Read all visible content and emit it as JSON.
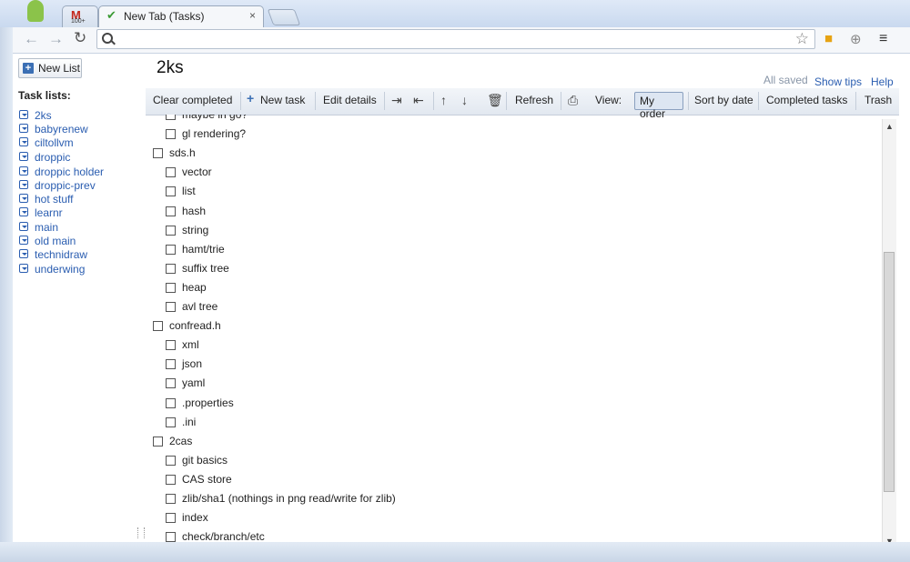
{
  "browser": {
    "tab_gmail_icon": "M",
    "tab_gmail_count": "100+",
    "active_tab_title": "New Tab (Tasks)",
    "tab_close": "×",
    "nav_back": "←",
    "nav_forward": "→",
    "nav_reload": "C",
    "address_value": "",
    "star": "☆",
    "ext_lock": "🔒",
    "ext_download": "⊕",
    "menu": "≡"
  },
  "app": {
    "new_list_label": "New List",
    "list_title": "2ks",
    "status": "All saved",
    "show_tips": "Show tips",
    "help": "Help"
  },
  "sidebar": {
    "heading": "Task lists:",
    "items": [
      {
        "label": "2ks"
      },
      {
        "label": "babyrenew"
      },
      {
        "label": "ciltollvm"
      },
      {
        "label": "droppic"
      },
      {
        "label": "droppic holder"
      },
      {
        "label": "droppic-prev"
      },
      {
        "label": "hot stuff"
      },
      {
        "label": "learnr"
      },
      {
        "label": "main"
      },
      {
        "label": "old main"
      },
      {
        "label": "technidraw"
      },
      {
        "label": "underwing"
      }
    ]
  },
  "actionbar": {
    "clear_completed": "Clear completed",
    "new_task": "New task",
    "edit_details": "Edit details",
    "refresh": "Refresh",
    "view_label": "View:",
    "my_order": "My order",
    "sort_by_date": "Sort by date",
    "completed_tasks": "Completed tasks",
    "trash": "Trash"
  },
  "tasks": [
    {
      "title": "maybe in go?",
      "level": 1
    },
    {
      "title": "gl rendering?",
      "level": 1
    },
    {
      "title": "sds.h",
      "level": 0
    },
    {
      "title": "vector",
      "level": 1
    },
    {
      "title": "list",
      "level": 1
    },
    {
      "title": "hash",
      "level": 1
    },
    {
      "title": "string",
      "level": 1
    },
    {
      "title": "hamt/trie",
      "level": 1
    },
    {
      "title": "suffix tree",
      "level": 1
    },
    {
      "title": "heap",
      "level": 1
    },
    {
      "title": "avl tree",
      "level": 1
    },
    {
      "title": "confread.h",
      "level": 0
    },
    {
      "title": "xml",
      "level": 1
    },
    {
      "title": "json",
      "level": 1
    },
    {
      "title": "yaml",
      "level": 1
    },
    {
      "title": ".properties",
      "level": 1
    },
    {
      "title": ".ini",
      "level": 1
    },
    {
      "title": "2cas",
      "level": 0
    },
    {
      "title": "git basics",
      "level": 1
    },
    {
      "title": "CAS store",
      "level": 1
    },
    {
      "title": "zlib/sha1 (nothings in png read/write for zlib)",
      "level": 1
    },
    {
      "title": "index",
      "level": 1
    },
    {
      "title": "check/branch/etc",
      "level": 1
    }
  ]
}
